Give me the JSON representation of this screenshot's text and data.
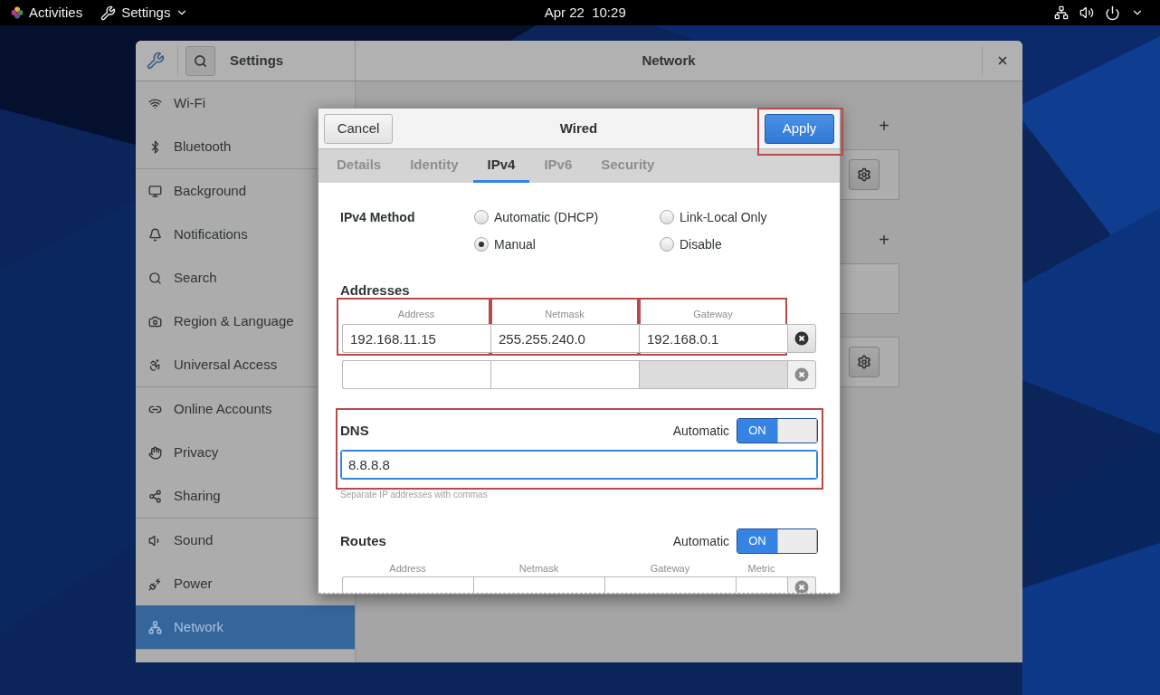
{
  "top_bar": {
    "activities": "Activities",
    "app_menu": "Settings",
    "clock": "Apr 22  10:29"
  },
  "settings_window": {
    "title": "Settings",
    "panel_title": "Network",
    "sidebar": {
      "groups": [
        {
          "items": [
            {
              "label": "Wi-Fi",
              "selected": false
            },
            {
              "label": "Bluetooth",
              "selected": false
            }
          ]
        },
        {
          "items": [
            {
              "label": "Background",
              "selected": false
            },
            {
              "label": "Notifications",
              "selected": false
            },
            {
              "label": "Search",
              "selected": false
            },
            {
              "label": "Region & Language",
              "selected": false
            },
            {
              "label": "Universal Access",
              "selected": false
            }
          ]
        },
        {
          "items": [
            {
              "label": "Online Accounts",
              "selected": false
            },
            {
              "label": "Privacy",
              "selected": false
            },
            {
              "label": "Sharing",
              "selected": false
            }
          ]
        },
        {
          "items": [
            {
              "label": "Sound",
              "selected": false
            },
            {
              "label": "Power",
              "selected": false
            },
            {
              "label": "Network",
              "selected": true
            }
          ]
        }
      ]
    },
    "network_panel": {
      "sections": [
        {
          "add_button": "+",
          "cards": [
            {
              "kind": "settings"
            }
          ]
        },
        {
          "add_button": "+",
          "cards": [
            {
              "kind": "blank"
            },
            {
              "kind": "settings"
            }
          ]
        }
      ]
    }
  },
  "dialog": {
    "title": "Wired",
    "cancel_button": {
      "label": "Cancel"
    },
    "apply_button": {
      "label": "Apply",
      "highlighted": true
    },
    "tabs": [
      {
        "label": "Details",
        "selected": false
      },
      {
        "label": "Identity",
        "selected": false
      },
      {
        "label": "IPv4",
        "selected": true
      },
      {
        "label": "IPv6",
        "selected": false
      },
      {
        "label": "Security",
        "selected": false
      }
    ],
    "method": {
      "label": "IPv4 Method",
      "options": [
        {
          "label": "Automatic (DHCP)",
          "selected": false
        },
        {
          "label": "Link-Local Only",
          "selected": false
        },
        {
          "label": "Manual",
          "selected": true
        },
        {
          "label": "Disable",
          "selected": false
        }
      ]
    },
    "addresses": {
      "title": "Addresses",
      "columns": [
        {
          "label": "Address",
          "highlighted": true
        },
        {
          "label": "Netmask",
          "highlighted": true
        },
        {
          "label": "Gateway",
          "highlighted": true
        }
      ],
      "rows": [
        {
          "cells": [
            {
              "value": "192.168.11.15",
              "disabled": false
            },
            {
              "value": "255.255.240.0",
              "disabled": false
            },
            {
              "value": "192.168.0.1",
              "disabled": false
            }
          ],
          "delete_disabled": false
        },
        {
          "cells": [
            {
              "disabled": false
            },
            {
              "disabled": false
            },
            {
              "disabled": true
            }
          ],
          "delete_disabled": true
        }
      ]
    },
    "dns": {
      "title": "DNS",
      "highlighted": true,
      "automatic": {
        "label": "Automatic",
        "state_text": "ON",
        "on": true
      },
      "value": "8.8.8.8",
      "focused": true,
      "hint": "Separate IP addresses with commas"
    },
    "routes": {
      "title": "Routes",
      "automatic": {
        "label": "Automatic",
        "state_text": "ON",
        "on": true
      },
      "columns": [
        {
          "label": "Address"
        },
        {
          "label": "Netmask"
        },
        {
          "label": "Gateway"
        },
        {
          "label": "Metric"
        }
      ],
      "rows": [
        {
          "cells": [
            {
              "disabled": false
            },
            {
              "disabled": false
            },
            {
              "disabled": false
            },
            {
              "disabled": false
            }
          ],
          "delete_disabled": true
        }
      ]
    }
  }
}
